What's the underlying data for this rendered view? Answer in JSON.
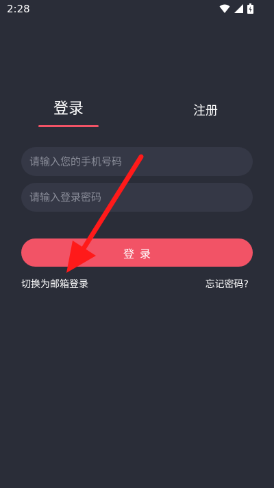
{
  "status_bar": {
    "time": "2:28",
    "icons": [
      "wifi-icon",
      "cellular-signal-icon",
      "battery-icon"
    ]
  },
  "tabs": [
    {
      "label": "登录",
      "active": true
    },
    {
      "label": "注册",
      "active": false
    }
  ],
  "form": {
    "phone_placeholder": "请输入您的手机号码",
    "phone_value": "",
    "password_placeholder": "请输入登录密码",
    "password_value": "",
    "login_button_label": "登录"
  },
  "links": {
    "switch_email": "切换为邮箱登录",
    "forgot_password": "忘记密码?"
  },
  "colors": {
    "background": "#2a2d38",
    "input_background": "#353846",
    "accent": "#f25366",
    "annotation": "#ff1a1a"
  }
}
